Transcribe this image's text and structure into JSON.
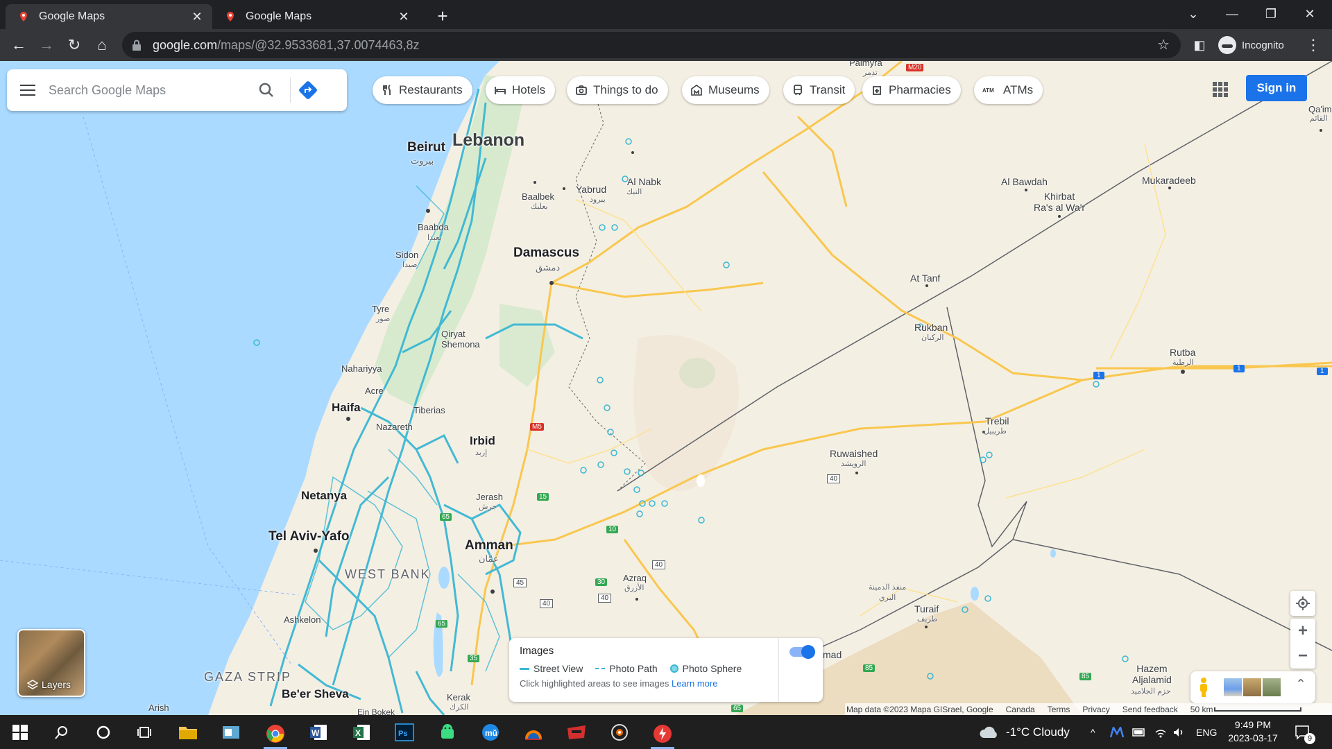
{
  "browser": {
    "tabs": [
      {
        "title": "Google Maps",
        "active": true
      },
      {
        "title": "Google Maps",
        "active": false
      }
    ],
    "url_host": "google.com",
    "url_path": "/maps/@32.9533681,37.0074463,8z",
    "profile_label": "Incognito"
  },
  "search": {
    "placeholder": "Search Google Maps"
  },
  "chips": [
    "Restaurants",
    "Hotels",
    "Things to do",
    "Museums",
    "Transit",
    "Pharmacies",
    "ATMs"
  ],
  "sign_in_label": "Sign in",
  "labels": {
    "lebanon": "Lebanon",
    "beirut": "Beirut",
    "beirut_ar": "بيروت",
    "baabda": "Baabda",
    "baabda_ar": "بعبدا",
    "baalbek": "Baalbek",
    "baalbek_ar": "بعلبك",
    "sidon": "Sidon",
    "sidon_ar": "صيدا",
    "tyre": "Tyre",
    "tyre_ar": "صور",
    "yabrud": "Yabrud",
    "yabrud_ar": "يبرود",
    "al_nabk": "Al Nabk",
    "al_nabk_ar": "النبك",
    "damascus": "Damascus",
    "damascus_ar": "دمشق",
    "qiryat_shemona": "Qiryat\nShemona",
    "nahariyya": "Nahariyya",
    "acre": "Acre",
    "haifa": "Haifa",
    "tiberias": "Tiberias",
    "nazareth": "Nazareth",
    "irbid": "Irbid",
    "irbid_ar": "إربد",
    "netanya": "Netanya",
    "jerash": "Jerash",
    "jerash_ar": "جرش",
    "tel_aviv": "Tel Aviv-Yafo",
    "west_bank": "WEST BANK",
    "amman": "Amman",
    "amman_ar": "عمّان",
    "azraq": "Azraq",
    "azraq_ar": "الأزرق",
    "ashkelon": "Ashkelon",
    "gaza_strip": "GAZA STRIP",
    "arish": "Arish",
    "beer_sheva": "Be'er Sheva",
    "kerak": "Kerak",
    "kerak_ar": "الكرك",
    "ein_bokek": "Ein Bokek",
    "palmyra": "Palmyra",
    "palmyra_ar": "تدمر",
    "al_bawdah": "Al Bawdah",
    "khirbat": "Khirbat\nRa's al Wa'r",
    "mukaradeeb": "Mukaradeeb",
    "qaim": "Qa'im",
    "qaim_ar": "القائم",
    "at_tanf": "At Tanf",
    "rukban": "Rukban",
    "rukban_ar": "الركبان",
    "rutba": "Rutba",
    "rutba_ar": "الرطبة",
    "trebil": "Trebil",
    "trebil_ar": "طريبيل",
    "ruwaished": "Ruwaished",
    "ruwaished_ar": "الرويشد",
    "mafraq_ar": "منفذ الدمينة\nالبري",
    "turaif": "Turaif",
    "turaif_ar": "طريف",
    "hazem": "Hazem\nAljalamid",
    "hazem_ar": "حزم الجلاميد",
    "muhammad_partial": "mad"
  },
  "road_shields": [
    "M20",
    "M5",
    "15",
    "65",
    "10",
    "40",
    "45",
    "40",
    "40",
    "30",
    "65",
    "35",
    "40",
    "1",
    "1",
    "1",
    "85",
    "85",
    "65"
  ],
  "layers_label": "Layers",
  "images_panel": {
    "title": "Images",
    "street_view": "Street View",
    "photo_path": "Photo Path",
    "photo_sphere": "Photo Sphere",
    "hint": "Click highlighted areas to see images",
    "learn_more": "Learn more",
    "toggle_on": true
  },
  "attribution": {
    "map_data": "Map data ©2023 Mapa GISrael, Google",
    "region": "Canada",
    "terms": "Terms",
    "privacy": "Privacy",
    "feedback": "Send feedback",
    "scale": "50 km"
  },
  "taskbar": {
    "weather": "-1°C  Cloudy",
    "lang": "ENG",
    "time": "9:49 PM",
    "date": "2023-03-17",
    "notifications": "9"
  },
  "colors": {
    "water": "#aadaff",
    "land": "#f4efe3",
    "green": "#cfe8c8",
    "desert": "#ecdcc0",
    "highway": "#f9c74f",
    "street_view": "#3ab7d4",
    "accent": "#1a73e8"
  }
}
